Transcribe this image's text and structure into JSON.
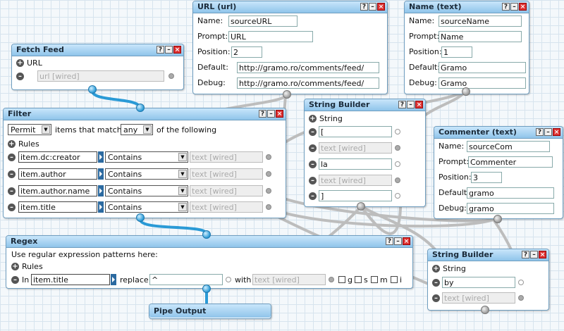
{
  "fetch_feed": {
    "title": "Fetch Feed",
    "url_label": "URL",
    "url_wired": "url [wired]"
  },
  "url_input": {
    "title": "URL (url)",
    "name_label": "Name:",
    "name_value": "sourceURL",
    "prompt_label": "Prompt:",
    "prompt_value": "URL",
    "position_label": "Position:",
    "position_value": "2",
    "default_label": "Default:",
    "default_value": "http://gramo.ro/comments/feed/",
    "debug_label": "Debug:",
    "debug_value": "http://gramo.ro/comments/feed/"
  },
  "name_input": {
    "title": "Name (text)",
    "name_label": "Name:",
    "name_value": "sourceName",
    "prompt_label": "Prompt:",
    "prompt_value": "Name",
    "position_label": "Position:",
    "position_value": "1",
    "default_label": "Default:",
    "default_value": "Gramo",
    "debug_label": "Debug:",
    "debug_value": "Gramo"
  },
  "filter": {
    "title": "Filter",
    "mode": "Permit",
    "middle_text": "items that match",
    "match": "any",
    "tail_text": "of the following",
    "rules_label": "Rules",
    "rules": [
      {
        "field": "item.dc:creator",
        "op": "Contains",
        "value": "text [wired]"
      },
      {
        "field": "item.author",
        "op": "Contains",
        "value": "text [wired]"
      },
      {
        "field": "item.author.name",
        "op": "Contains",
        "value": "text [wired]"
      },
      {
        "field": "item.title",
        "op": "Contains",
        "value": "text [wired]"
      }
    ]
  },
  "string_builder_1": {
    "title": "String Builder",
    "string_label": "String",
    "items": [
      {
        "value": "[",
        "wired": false
      },
      {
        "value": "text [wired]",
        "wired": true
      },
      {
        "value": "la",
        "wired": false
      },
      {
        "value": "text [wired]",
        "wired": true
      },
      {
        "value": "]",
        "wired": false
      }
    ]
  },
  "commenter_input": {
    "title": "Commenter (text)",
    "name_label": "Name:",
    "name_value": "sourceCom",
    "prompt_label": "Prompt:",
    "prompt_value": "Commenter",
    "position_label": "Position:",
    "position_value": "3",
    "default_label": "Default:",
    "default_value": "gramo",
    "debug_label": "Debug:",
    "debug_value": "gramo"
  },
  "regex": {
    "title": "Regex",
    "description": "Use regular expression patterns here:",
    "rules_label": "Rules",
    "in_label": "In",
    "field": "item.title",
    "replace_label": "replace",
    "pattern": "^",
    "with_label": "with",
    "with_value": "text [wired]",
    "flags": [
      "g",
      "s",
      "m",
      "i"
    ]
  },
  "string_builder_2": {
    "title": "String Builder",
    "string_label": "String",
    "items": [
      {
        "value": "by",
        "wired": false
      },
      {
        "value": "text [wired]",
        "wired": true
      }
    ]
  },
  "pipe_output": {
    "title": "Pipe Output"
  },
  "window_buttons": {
    "help": "?",
    "minimize": "–",
    "close": "×"
  }
}
